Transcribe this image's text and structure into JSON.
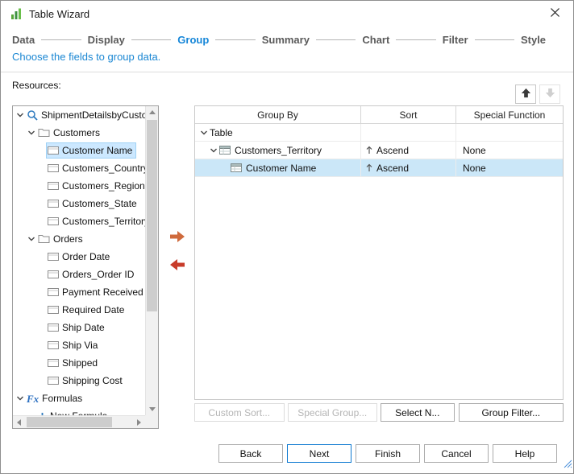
{
  "colors": {
    "accent_blue": "#1586d8",
    "tree_selection": "#cce8ff",
    "table_selection": "#cbe7f8",
    "add_arrow": "#cf6a3c",
    "remove_arrow": "#c83c2a"
  },
  "window": {
    "title": "Table Wizard"
  },
  "icons": {
    "app_icon": "green-bar-chart",
    "close_icon": "x",
    "query_icon": "magnifier",
    "folder_icon": "folder",
    "field_icon": "column-chip",
    "formulas_icon": "Fx",
    "new_formula_icon": "plus",
    "group_icon": "grouped-table",
    "sort_ascend_icon": "up-arrow",
    "move_up_icon": "up-arrow",
    "move_down_icon": "down-arrow",
    "add_field_icon": "right-arrow",
    "remove_field_icon": "left-arrow"
  },
  "steps": {
    "items": [
      {
        "label": "Data",
        "active": false
      },
      {
        "label": "Display",
        "active": false
      },
      {
        "label": "Group",
        "active": true
      },
      {
        "label": "Summary",
        "active": false
      },
      {
        "label": "Chart",
        "active": false
      },
      {
        "label": "Filter",
        "active": false
      },
      {
        "label": "Style",
        "active": false
      }
    ],
    "subtitle": "Choose the fields to group data."
  },
  "resources": {
    "label": "Resources:",
    "tree": [
      {
        "label": "ShipmentDetailsbyCustom",
        "type": "query",
        "level": 0,
        "expanded": true,
        "selected": false
      },
      {
        "label": "Customers",
        "type": "folder",
        "level": 1,
        "expanded": true,
        "selected": false
      },
      {
        "label": "Customer Name",
        "type": "field",
        "level": 2,
        "expanded": false,
        "selected": true
      },
      {
        "label": "Customers_Country",
        "type": "field",
        "level": 2,
        "expanded": false,
        "selected": false
      },
      {
        "label": "Customers_Region",
        "type": "field",
        "level": 2,
        "expanded": false,
        "selected": false
      },
      {
        "label": "Customers_State",
        "type": "field",
        "level": 2,
        "expanded": false,
        "selected": false
      },
      {
        "label": "Customers_Territory",
        "type": "field",
        "level": 2,
        "expanded": false,
        "selected": false
      },
      {
        "label": "Orders",
        "type": "folder",
        "level": 1,
        "expanded": true,
        "selected": false
      },
      {
        "label": "Order Date",
        "type": "field",
        "level": 2,
        "expanded": false,
        "selected": false
      },
      {
        "label": "Orders_Order ID",
        "type": "field",
        "level": 2,
        "expanded": false,
        "selected": false
      },
      {
        "label": "Payment Received",
        "type": "field",
        "level": 2,
        "expanded": false,
        "selected": false
      },
      {
        "label": "Required Date",
        "type": "field",
        "level": 2,
        "expanded": false,
        "selected": false
      },
      {
        "label": "Ship Date",
        "type": "field",
        "level": 2,
        "expanded": false,
        "selected": false
      },
      {
        "label": "Ship Via",
        "type": "field",
        "level": 2,
        "expanded": false,
        "selected": false
      },
      {
        "label": "Shipped",
        "type": "field",
        "level": 2,
        "expanded": false,
        "selected": false
      },
      {
        "label": "Shipping Cost",
        "type": "field",
        "level": 2,
        "expanded": false,
        "selected": false
      },
      {
        "label": "Formulas",
        "type": "formulas",
        "level": 0,
        "expanded": true,
        "selected": false
      },
      {
        "label": "New Formula",
        "type": "new-formula",
        "level": 1,
        "expanded": false,
        "selected": false
      }
    ]
  },
  "group_table": {
    "columns": [
      "Group By",
      "Sort",
      "Special Function"
    ],
    "rows": [
      {
        "group_by": "Table",
        "sort": "",
        "special": "",
        "level": 0,
        "expanded": true,
        "icon": "none",
        "selected": false
      },
      {
        "group_by": "Customers_Territory",
        "sort": "Ascend",
        "special": "None",
        "level": 1,
        "expanded": true,
        "icon": "group",
        "selected": false
      },
      {
        "group_by": "Customer Name",
        "sort": "Ascend",
        "special": "None",
        "level": 2,
        "expanded": false,
        "icon": "group",
        "selected": true
      }
    ]
  },
  "table_buttons": [
    {
      "label": "Custom Sort...",
      "enabled": false
    },
    {
      "label": "Special Group...",
      "enabled": false
    },
    {
      "label": "Select N...",
      "enabled": true
    },
    {
      "label": "Group Filter...",
      "enabled": true
    }
  ],
  "footer_buttons": [
    {
      "label": "Back",
      "default": false
    },
    {
      "label": "Next",
      "default": true
    },
    {
      "label": "Finish",
      "default": false
    },
    {
      "label": "Cancel",
      "default": false
    },
    {
      "label": "Help",
      "default": false
    }
  ]
}
